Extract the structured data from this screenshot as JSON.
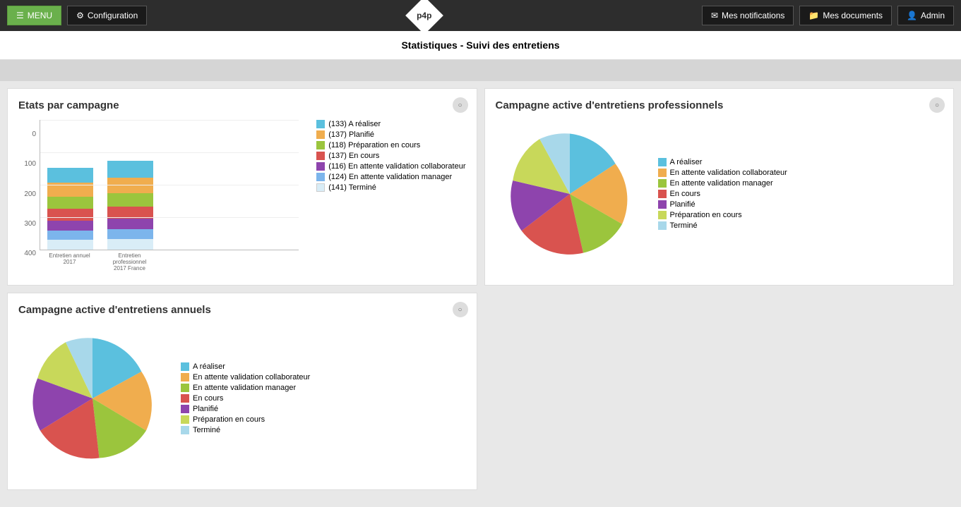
{
  "header": {
    "menu_label": "MENU",
    "config_label": "Configuration",
    "logo_text": "p4p",
    "notifications_label": "Mes notifications",
    "documents_label": "Mes documents",
    "admin_label": "Admin"
  },
  "page_title": "Statistiques - Suivi des entretiens",
  "charts": {
    "bar_chart": {
      "title": "Etats par campagne",
      "y_axis": [
        "0",
        "100",
        "200",
        "300",
        "400"
      ],
      "groups": [
        {
          "label": "Entretien annuel 2017"
        },
        {
          "label": "Entretien professionnel 2017 France"
        }
      ],
      "legend": [
        {
          "label": "(133) A réaliser",
          "color": "#5bc0de"
        },
        {
          "label": "(137) Planifié",
          "color": "#f0ad4e"
        },
        {
          "label": "(118) Préparation en cours",
          "color": "#9bc53d"
        },
        {
          "label": "(137) En cours",
          "color": "#d9534f"
        },
        {
          "label": "(116) En attente validation collaborateur",
          "color": "#8e44ad"
        },
        {
          "label": "(124) En attente validation manager",
          "color": "#5bc0de"
        },
        {
          "label": "(141) Terminé",
          "color": "#d9edf7"
        }
      ]
    },
    "pie_pro": {
      "title": "Campagne active d'entretiens professionnels",
      "legend": [
        {
          "label": "A réaliser",
          "color": "#5bc0de"
        },
        {
          "label": "En attente validation collaborateur",
          "color": "#f0ad4e"
        },
        {
          "label": "En attente validation manager",
          "color": "#9bc53d"
        },
        {
          "label": "En cours",
          "color": "#d9534f"
        },
        {
          "label": "Planifié",
          "color": "#8e44ad"
        },
        {
          "label": "Préparation en cours",
          "color": "#c8d85a"
        },
        {
          "label": "Terminé",
          "color": "#a8d8ea"
        }
      ]
    },
    "pie_annuel": {
      "title": "Campagne active d'entretiens annuels",
      "legend": [
        {
          "label": "A réaliser",
          "color": "#5bc0de"
        },
        {
          "label": "En attente validation collaborateur",
          "color": "#f0ad4e"
        },
        {
          "label": "En attente validation manager",
          "color": "#9bc53d"
        },
        {
          "label": "En cours",
          "color": "#d9534f"
        },
        {
          "label": "Planifié",
          "color": "#8e44ad"
        },
        {
          "label": "Préparation en cours",
          "color": "#c8d85a"
        },
        {
          "label": "Terminé",
          "color": "#a8d8ea"
        }
      ]
    }
  }
}
